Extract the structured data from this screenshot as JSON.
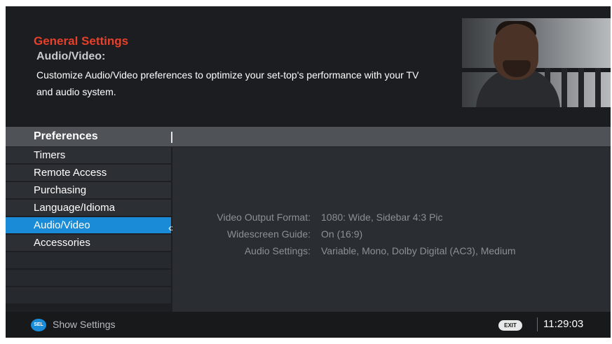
{
  "header": {
    "title": "General Settings",
    "subtitle": "Audio/Video:",
    "description": "Customize Audio/Video preferences to optimize your set-top's performance with your TV and audio system."
  },
  "section": {
    "title": "Preferences"
  },
  "menu": {
    "items": [
      {
        "label": "Timers"
      },
      {
        "label": "Remote Access"
      },
      {
        "label": "Purchasing"
      },
      {
        "label": "Language/Idioma"
      },
      {
        "label": "Audio/Video",
        "selected": true
      },
      {
        "label": "Accessories"
      }
    ],
    "selected_arrows": "‹›"
  },
  "content": {
    "rows": [
      {
        "label": "Video Output Format:",
        "value": "1080: Wide, Sidebar 4:3 Pic"
      },
      {
        "label": "Widescreen Guide:",
        "value": "On (16:9)"
      },
      {
        "label": "Audio Settings:",
        "value": "Variable, Mono, Dolby Digital (AC3), Medium"
      }
    ]
  },
  "footer": {
    "button_glyph": "SEL",
    "button_label": "Show Settings",
    "exit_label": "EXIT",
    "time": "11:29:03"
  },
  "colors": {
    "accent_red": "#e8402a",
    "selection_blue": "#1a8bd6",
    "background": "#1d1f22"
  },
  "icons": {
    "footer_button": "blue-round-button-icon",
    "exit_button": "exit-pill-icon",
    "selection": "left-right-arrows-icon"
  }
}
